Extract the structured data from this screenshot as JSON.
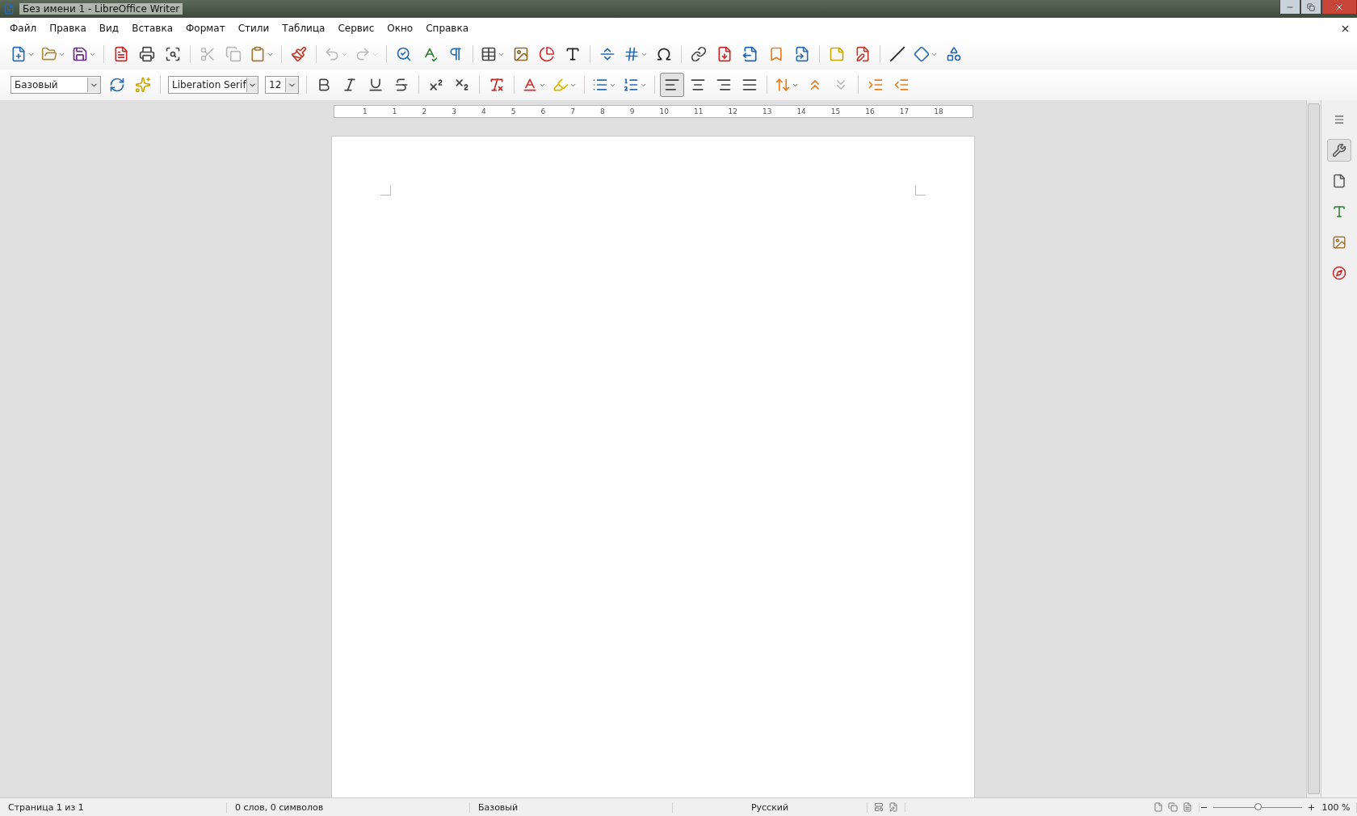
{
  "window": {
    "title": "Без имени 1 - LibreOffice Writer"
  },
  "menu": [
    {
      "label": "Файл"
    },
    {
      "label": "Правка"
    },
    {
      "label": "Вид"
    },
    {
      "label": "Вставка"
    },
    {
      "label": "Формат"
    },
    {
      "label": "Стили"
    },
    {
      "label": "Таблица"
    },
    {
      "label": "Сервис"
    },
    {
      "label": "Окно"
    },
    {
      "label": "Справка"
    }
  ],
  "standard_toolbar": [
    {
      "kind": "button",
      "dropdown": true,
      "disabled": false
    },
    {
      "kind": "button",
      "dropdown": true,
      "disabled": false
    },
    {
      "kind": "button",
      "dropdown": true,
      "disabled": false
    },
    {
      "kind": "separator"
    },
    {
      "kind": "button",
      "dropdown": false,
      "disabled": false
    },
    {
      "kind": "button",
      "dropdown": false,
      "disabled": false
    },
    {
      "kind": "button",
      "dropdown": false,
      "disabled": false
    },
    {
      "kind": "separator"
    },
    {
      "kind": "button",
      "dropdown": false,
      "disabled": true
    },
    {
      "kind": "button",
      "dropdown": false,
      "disabled": true
    },
    {
      "kind": "button",
      "dropdown": true,
      "disabled": false
    },
    {
      "kind": "separator"
    },
    {
      "kind": "button",
      "dropdown": false,
      "disabled": false
    },
    {
      "kind": "separator"
    },
    {
      "kind": "button",
      "dropdown": true,
      "disabled": true
    },
    {
      "kind": "button",
      "dropdown": true,
      "disabled": true
    },
    {
      "kind": "separator"
    },
    {
      "kind": "button",
      "dropdown": false,
      "disabled": false
    },
    {
      "kind": "button",
      "dropdown": false,
      "disabled": false
    },
    {
      "kind": "button",
      "dropdown": false,
      "disabled": false
    },
    {
      "kind": "separator"
    },
    {
      "kind": "button",
      "dropdown": true,
      "disabled": false
    },
    {
      "kind": "button",
      "dropdown": false,
      "disabled": false
    },
    {
      "kind": "button",
      "dropdown": false,
      "disabled": false
    },
    {
      "kind": "button",
      "dropdown": false,
      "disabled": false
    },
    {
      "kind": "separator"
    },
    {
      "kind": "button",
      "dropdown": false,
      "disabled": false
    },
    {
      "kind": "button",
      "dropdown": true,
      "disabled": false
    },
    {
      "kind": "button",
      "dropdown": false,
      "disabled": false
    },
    {
      "kind": "separator"
    },
    {
      "kind": "button",
      "dropdown": false,
      "disabled": false
    },
    {
      "kind": "button",
      "dropdown": false,
      "disabled": false
    },
    {
      "kind": "button",
      "dropdown": false,
      "disabled": false
    },
    {
      "kind": "button",
      "dropdown": false,
      "disabled": false
    },
    {
      "kind": "button",
      "dropdown": false,
      "disabled": false
    },
    {
      "kind": "separator"
    },
    {
      "kind": "button",
      "dropdown": false,
      "disabled": false
    },
    {
      "kind": "button",
      "dropdown": false,
      "disabled": false
    },
    {
      "kind": "separator"
    },
    {
      "kind": "button",
      "dropdown": false,
      "disabled": false
    },
    {
      "kind": "button",
      "dropdown": true,
      "disabled": false
    },
    {
      "kind": "button",
      "dropdown": false,
      "disabled": false
    }
  ],
  "formatting_toolbar": [
    {
      "kind": "combo",
      "value": "Базовый"
    },
    {
      "kind": "button",
      "dropdown": false,
      "disabled": false,
      "selected": false
    },
    {
      "kind": "button",
      "dropdown": false,
      "disabled": false,
      "selected": false
    },
    {
      "kind": "separator"
    },
    {
      "kind": "combo",
      "value": "Liberation Serif"
    },
    {
      "kind": "combo",
      "value": "12"
    },
    {
      "kind": "separator"
    },
    {
      "kind": "button",
      "dropdown": false,
      "disabled": false,
      "selected": false
    },
    {
      "kind": "button",
      "dropdown": false,
      "disabled": false,
      "selected": false
    },
    {
      "kind": "button",
      "dropdown": false,
      "disabled": false,
      "selected": false
    },
    {
      "kind": "button",
      "dropdown": false,
      "disabled": false,
      "selected": false
    },
    {
      "kind": "separator"
    },
    {
      "kind": "button",
      "dropdown": false,
      "disabled": false,
      "selected": false
    },
    {
      "kind": "button",
      "dropdown": false,
      "disabled": false,
      "selected": false
    },
    {
      "kind": "separator"
    },
    {
      "kind": "button",
      "dropdown": false,
      "disabled": false,
      "selected": false
    },
    {
      "kind": "separator"
    },
    {
      "kind": "button",
      "dropdown": true,
      "disabled": false,
      "selected": false
    },
    {
      "kind": "button",
      "dropdown": true,
      "disabled": false,
      "selected": false
    },
    {
      "kind": "separator"
    },
    {
      "kind": "button",
      "dropdown": true,
      "disabled": false,
      "selected": false
    },
    {
      "kind": "button",
      "dropdown": true,
      "disabled": false,
      "selected": false
    },
    {
      "kind": "separator"
    },
    {
      "kind": "button",
      "dropdown": false,
      "disabled": false,
      "selected": true
    },
    {
      "kind": "button",
      "dropdown": false,
      "disabled": false,
      "selected": false
    },
    {
      "kind": "button",
      "dropdown": false,
      "disabled": false,
      "selected": false
    },
    {
      "kind": "button",
      "dropdown": false,
      "disabled": false,
      "selected": false
    },
    {
      "kind": "separator"
    },
    {
      "kind": "button",
      "dropdown": true,
      "disabled": false,
      "selected": false
    },
    {
      "kind": "button",
      "dropdown": false,
      "disabled": false,
      "selected": false
    },
    {
      "kind": "button",
      "dropdown": false,
      "disabled": true,
      "selected": false
    },
    {
      "kind": "separator"
    },
    {
      "kind": "button",
      "dropdown": false,
      "disabled": false,
      "selected": false
    },
    {
      "kind": "button",
      "dropdown": false,
      "disabled": false,
      "selected": false
    }
  ],
  "ruler": {
    "labels": [
      "1",
      "1",
      "2",
      "3",
      "4",
      "5",
      "6",
      "7",
      "8",
      "9",
      "10",
      "11",
      "12",
      "13",
      "14",
      "15",
      "16",
      "17",
      "18"
    ]
  },
  "status_bar": {
    "page": "Страница 1 из 1",
    "words": "0 слов, 0 символов",
    "page_style": "Базовый",
    "language": "Русский",
    "zoom": "100 %",
    "zoom_slider": {
      "level": 0.5
    }
  }
}
